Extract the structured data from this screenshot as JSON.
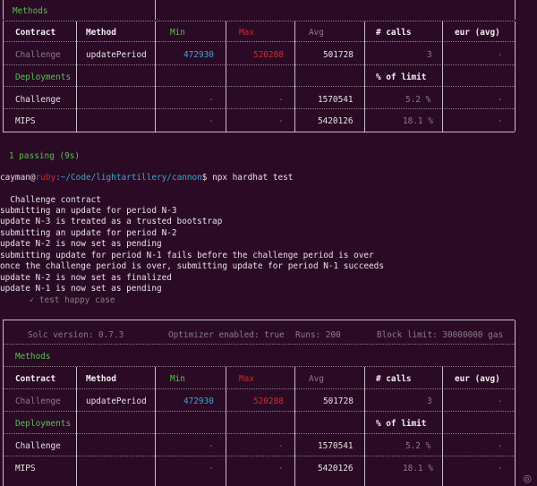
{
  "table_top": {
    "section_methods": "Methods",
    "headers": [
      "Contract",
      "Method",
      "Min",
      "Max",
      "Avg",
      "# calls",
      "eur (avg)"
    ],
    "row_method": [
      "Challenge",
      "updatePeriod",
      "472930",
      "520288",
      "501728",
      "3",
      "-"
    ],
    "section_deployments": "Deployments",
    "pct_limit": "% of limit",
    "row_deploy1": [
      "Challenge",
      "-",
      "-",
      "1570541",
      "5.2 %",
      "-"
    ],
    "row_deploy2": [
      "MIPS",
      "-",
      "-",
      "5420126",
      "18.1 %",
      "-"
    ]
  },
  "passing": "1 passing (9s)",
  "prompt": {
    "user": "cayman",
    "at": "@",
    "host": "ruby",
    "path": ":~/Code/lightartillery/cannon",
    "cmd": "$ npx hardhat test"
  },
  "output_lines": [
    "  Challenge contract",
    "submitting an update for period N-3",
    "update N-3 is treated as a trusted bootstrap",
    "submitting an update for period N-2",
    "update N-2 is now set as pending",
    "submitting update for period N-1 fails before the challenge period is over",
    "once the challenge period is over, submitting update for period N-1 succeeds",
    "update N-2 is now set as finalized",
    "update N-1 is now set as pending"
  ],
  "test_pass": "    ✓ test happy case",
  "table_bottom": {
    "solc": "Solc version: 0.7.3",
    "optimizer": "Optimizer enabled: true",
    "runs": "Runs: 200",
    "block": "Block limit: 30000000 gas",
    "section_methods": "Methods",
    "headers": [
      "Contract",
      "Method",
      "Min",
      "Max",
      "Avg",
      "# calls",
      "eur (avg)"
    ],
    "row_method": [
      "Challenge",
      "updatePeriod",
      "472930",
      "520288",
      "501728",
      "3",
      "-"
    ],
    "section_deployments": "Deployments",
    "pct_limit": "% of limit",
    "row_deploy1": [
      "Challenge",
      "-",
      "-",
      "1570541",
      "5.2 %",
      "-"
    ],
    "row_deploy2": [
      "MIPS",
      "-",
      "-",
      "5420126",
      "18.1 %",
      "-"
    ]
  }
}
